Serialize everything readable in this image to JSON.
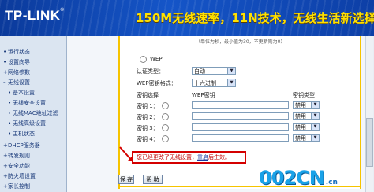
{
  "banner": {
    "logo": "TP-LINK",
    "logo_tm": "®",
    "slogan": "150M无线速率，11N技术，无线生活新选择"
  },
  "sidebar": {
    "items": [
      {
        "label": "运行状态",
        "bullet": "•"
      },
      {
        "label": "设置向导",
        "bullet": "•"
      },
      {
        "label": "网络参数",
        "bullet": "+"
      },
      {
        "label": "无线设置",
        "bullet": "-"
      },
      {
        "label": "基本设置",
        "bullet": "•"
      },
      {
        "label": "无线安全设置",
        "bullet": "•"
      },
      {
        "label": "无线MAC地址过滤",
        "bullet": "•"
      },
      {
        "label": "无线高级设置",
        "bullet": "•"
      },
      {
        "label": "主机状态",
        "bullet": "•"
      },
      {
        "label": "DHCP服务器",
        "bullet": "+"
      },
      {
        "label": "转发规则",
        "bullet": "+"
      },
      {
        "label": "安全功能",
        "bullet": "+"
      },
      {
        "label": "防火墙设置",
        "bullet": "+"
      },
      {
        "label": "家长控制",
        "bullet": "+"
      }
    ]
  },
  "form": {
    "note": "（单位为秒，最小值为30，不更新则为0）",
    "wep_label": "WEP",
    "auth_type_label": "认证类型：",
    "auth_type_value": "自动",
    "wep_format_label": "WEP密钥格式：",
    "wep_format_value": "十六进制",
    "col_key_select": "密钥选择",
    "col_wep_key": "WEP密钥",
    "col_key_type": "密钥类型",
    "keys": [
      {
        "label": "密钥 1：",
        "type": "禁用"
      },
      {
        "label": "密钥 2：",
        "type": "禁用"
      },
      {
        "label": "密钥 3：",
        "type": "禁用"
      },
      {
        "label": "密钥 4：",
        "type": "禁用"
      }
    ]
  },
  "alert": {
    "text": "您已经更改了无线设置，",
    "link": "重启",
    "suffix": "后生效。"
  },
  "buttons": {
    "save": "保 存",
    "help": "帮 助"
  },
  "watermark": {
    "main": "002CN",
    "sub": ".cn"
  },
  "colors": {
    "banner": "#1555c8",
    "slogan": "#ffe100",
    "alert_border": "#d40000",
    "panel_border": "#f6c400"
  }
}
